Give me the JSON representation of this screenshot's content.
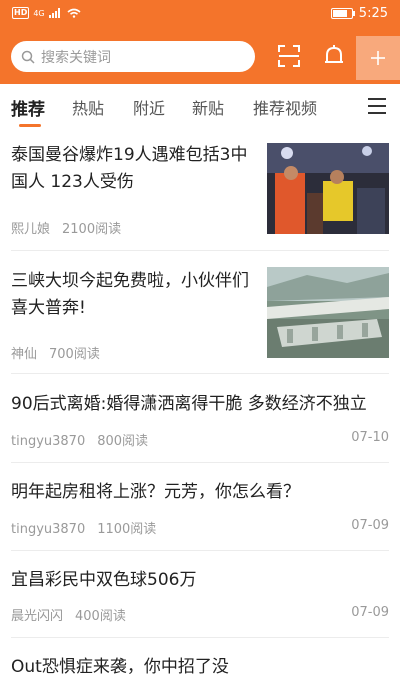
{
  "status": {
    "time": "5:25",
    "network": "HD",
    "signal": "4G"
  },
  "search": {
    "placeholder": "搜索关键词"
  },
  "tabs": [
    "推荐",
    "热贴",
    "附近",
    "新贴",
    "推荐视频"
  ],
  "feed": [
    {
      "title": "泰国曼谷爆炸19人遇难包括3中国人 123人受伤",
      "author": "熙儿娘",
      "reads": "2100阅读",
      "date": "",
      "thumb": "crowd-rescue-photo"
    },
    {
      "title": "三峡大坝今起免费啦，小伙伴们喜大普奔!",
      "author": "神仙",
      "reads": "700阅读",
      "date": "",
      "thumb": "dam-aerial-photo"
    },
    {
      "title": "90后式离婚:婚得潇洒离得干脆 多数经济不独立",
      "author": "tingyu3870",
      "reads": "800阅读",
      "date": "07-10"
    },
    {
      "title": "明年起房租将上涨？元芳，你怎么看？",
      "author": "tingyu3870",
      "reads": "1100阅读",
      "date": "07-09"
    },
    {
      "title": "宜昌彩民中双色球506万",
      "author": "晨光闪闪",
      "reads": "400阅读",
      "date": "07-09"
    },
    {
      "title": "Out恐惧症来袭，你中招了没",
      "author": "",
      "reads": "",
      "date": ""
    }
  ],
  "colors": {
    "accent": "#f4742b"
  }
}
